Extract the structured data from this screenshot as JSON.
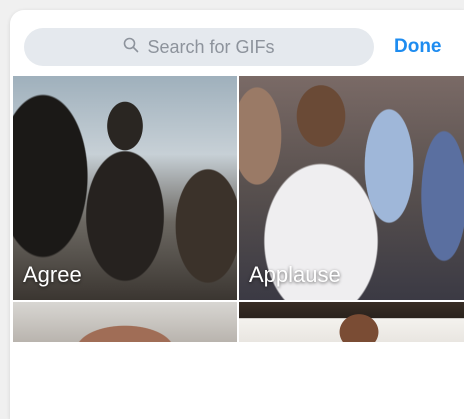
{
  "search": {
    "placeholder": "Search for GIFs",
    "icon": "search-icon"
  },
  "header": {
    "done_label": "Done"
  },
  "colors": {
    "accent": "#1e8cf0",
    "search_bg": "#e5e9ee"
  },
  "gifs": [
    {
      "label": "Agree"
    },
    {
      "label": "Applause"
    },
    {
      "label": ""
    },
    {
      "label": ""
    }
  ]
}
